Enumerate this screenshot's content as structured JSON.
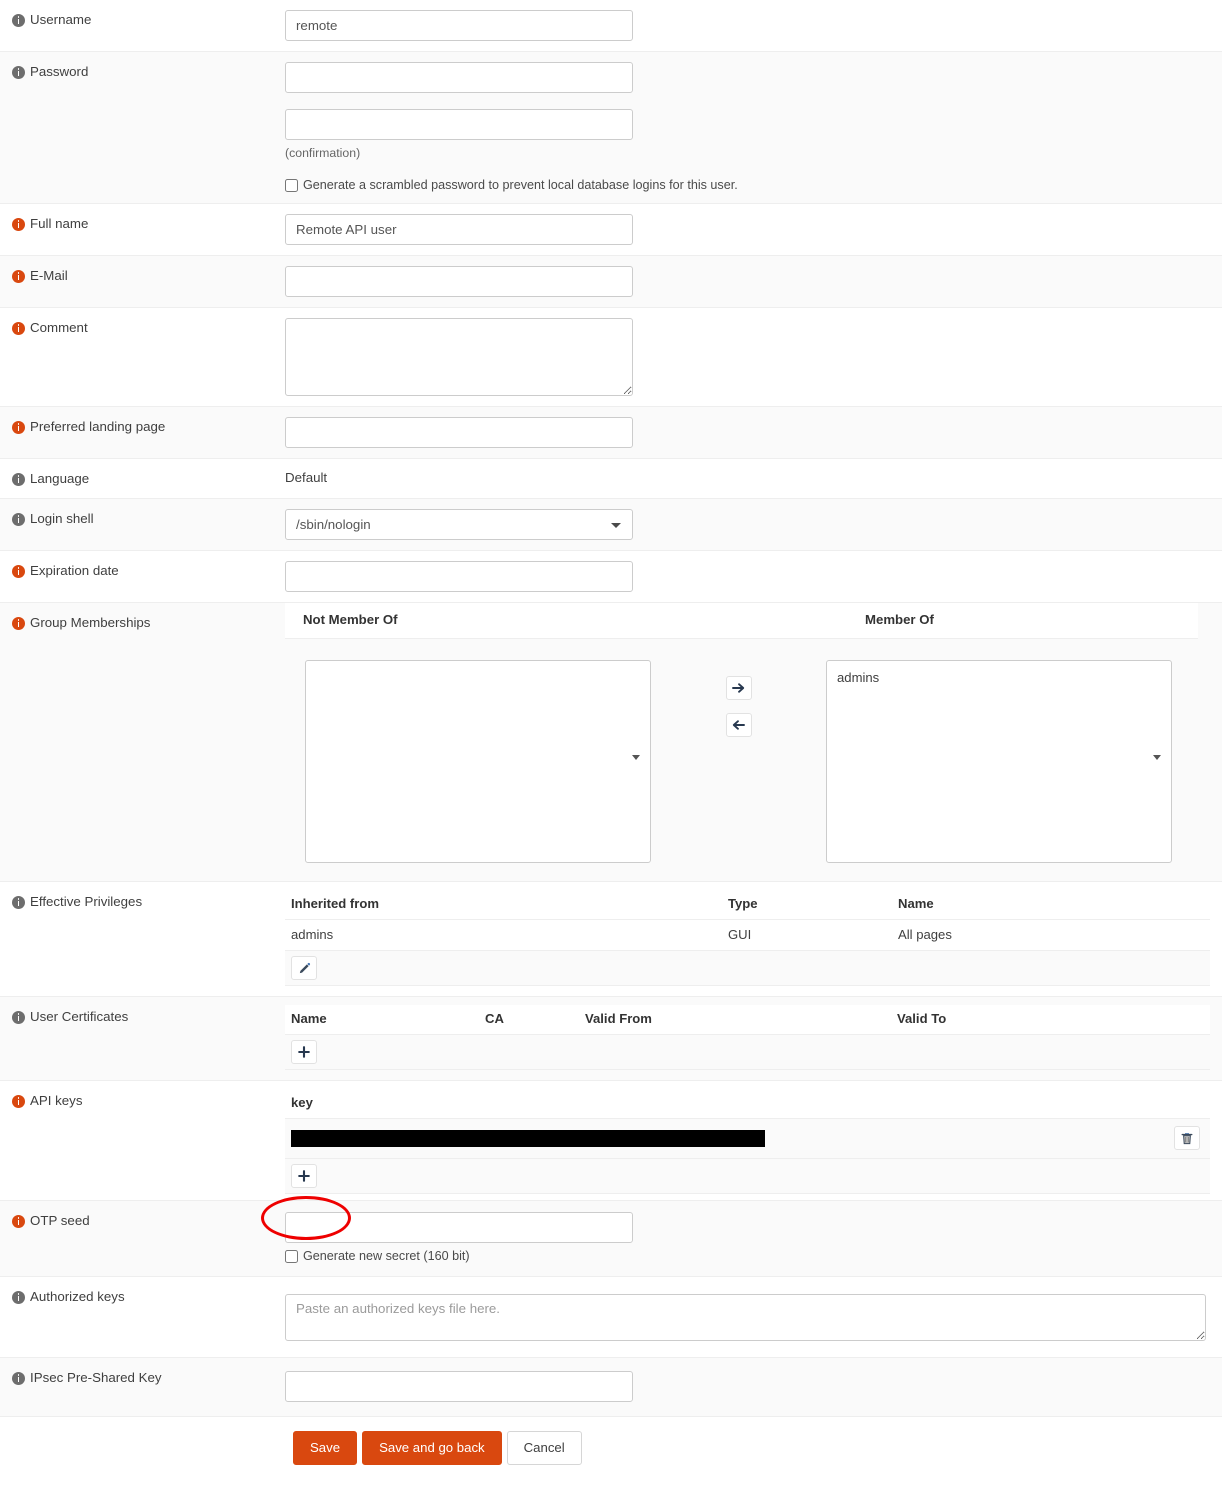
{
  "form": {
    "rows": [
      {
        "label": "Username",
        "icon": "info-icon-gray"
      },
      {
        "label": "Password",
        "icon": "info-icon-gray"
      },
      {
        "label": "Full name",
        "icon": "info-icon-orange"
      },
      {
        "label": "E-Mail",
        "icon": "info-icon-orange"
      },
      {
        "label": "Comment",
        "icon": "info-icon-orange"
      },
      {
        "label": "Preferred landing page",
        "icon": "info-icon-orange"
      },
      {
        "label": "Language",
        "icon": "info-icon-gray"
      },
      {
        "label": "Login shell",
        "icon": "info-icon-gray"
      },
      {
        "label": "Expiration date",
        "icon": "info-icon-orange"
      },
      {
        "label": "Group Memberships",
        "icon": "info-icon-orange"
      },
      {
        "label": "Effective Privileges",
        "icon": "info-icon-gray"
      },
      {
        "label": "User Certificates",
        "icon": "info-icon-gray"
      },
      {
        "label": "API keys",
        "icon": "info-icon-orange"
      },
      {
        "label": "OTP seed",
        "icon": "info-icon-orange"
      },
      {
        "label": "Authorized keys",
        "icon": "info-icon-gray"
      },
      {
        "label": "IPsec Pre-Shared Key",
        "icon": "info-icon-gray"
      }
    ],
    "username": {
      "value": "remote",
      "placeholder": ""
    },
    "password": {
      "value": "",
      "confirm_value": "",
      "confirm_note": "(confirmation)",
      "scramble_label": "Generate a scrambled password to prevent local database logins for this user.",
      "scramble_checked": false
    },
    "full_name": {
      "value": "Remote API user"
    },
    "email": {
      "value": ""
    },
    "comment": {
      "value": ""
    },
    "landing_page": {
      "value": ""
    },
    "language": {
      "value": "Default"
    },
    "login_shell": {
      "value": "/sbin/nologin"
    },
    "expiration_date": {
      "value": ""
    },
    "group_memberships": {
      "not_member_of_header": "Not Member Of",
      "member_of_header": "Member Of",
      "not_member_of": [],
      "member_of": [
        "admins"
      ],
      "add_button": "move-right-arrow-icon",
      "remove_button": "move-left-arrow-icon"
    },
    "effective_privileges": {
      "columns": [
        "Inherited from",
        "Type",
        "Name"
      ],
      "rows": [
        {
          "inherited_from": "admins",
          "type": "GUI",
          "name": "All pages"
        }
      ],
      "edit_button_icon": "pencil-icon"
    },
    "user_certificates": {
      "columns": [
        "Name",
        "CA",
        "Valid From",
        "Valid To"
      ],
      "rows": [],
      "add_button_icon": "plus-icon"
    },
    "api_keys": {
      "columns": [
        "key"
      ],
      "rows": [
        {
          "key": "",
          "redacted": true
        }
      ],
      "delete_button_icon": "trash-icon",
      "add_button_icon": "plus-icon"
    },
    "otp_seed": {
      "value": "",
      "generate_label": "Generate new secret (160 bit)",
      "generate_checked": false
    },
    "authorized_keys": {
      "value": "",
      "placeholder": "Paste an authorized keys file here."
    },
    "ipsec_psk": {
      "value": ""
    }
  },
  "actions": {
    "save": "Save",
    "save_and_go_back": "Save and go back",
    "cancel": "Cancel"
  },
  "annotation": {
    "shape": "red-ellipse-highlight",
    "target": "api-keys-add-button",
    "color": "#ee0000"
  }
}
